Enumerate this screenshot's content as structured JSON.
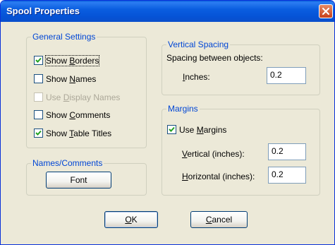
{
  "window": {
    "title": "Spool Properties"
  },
  "general": {
    "legend": "General Settings",
    "items": [
      {
        "label": "Show Borders",
        "checked": true,
        "enabled": true
      },
      {
        "label": "Show Names",
        "checked": false,
        "enabled": true
      },
      {
        "label": "Use Display Names",
        "checked": false,
        "enabled": false
      },
      {
        "label": "Show Comments",
        "checked": false,
        "enabled": true
      },
      {
        "label": "Show Table Titles",
        "checked": true,
        "enabled": true
      }
    ]
  },
  "names_comments": {
    "legend": "Names/Comments",
    "font_button": "Font"
  },
  "vertical_spacing": {
    "legend": "Vertical Spacing",
    "description": "Spacing between objects:",
    "inches_label": "Inches:",
    "inches_value": "0.2"
  },
  "margins": {
    "legend": "Margins",
    "use_margins_label": "Use Margins",
    "use_margins_checked": true,
    "vertical_label": "Vertical (inches):",
    "vertical_value": "0.2",
    "horizontal_label": "Horizontal (inches):",
    "horizontal_value": "0.2"
  },
  "buttons": {
    "ok": "OK",
    "cancel": "Cancel"
  }
}
